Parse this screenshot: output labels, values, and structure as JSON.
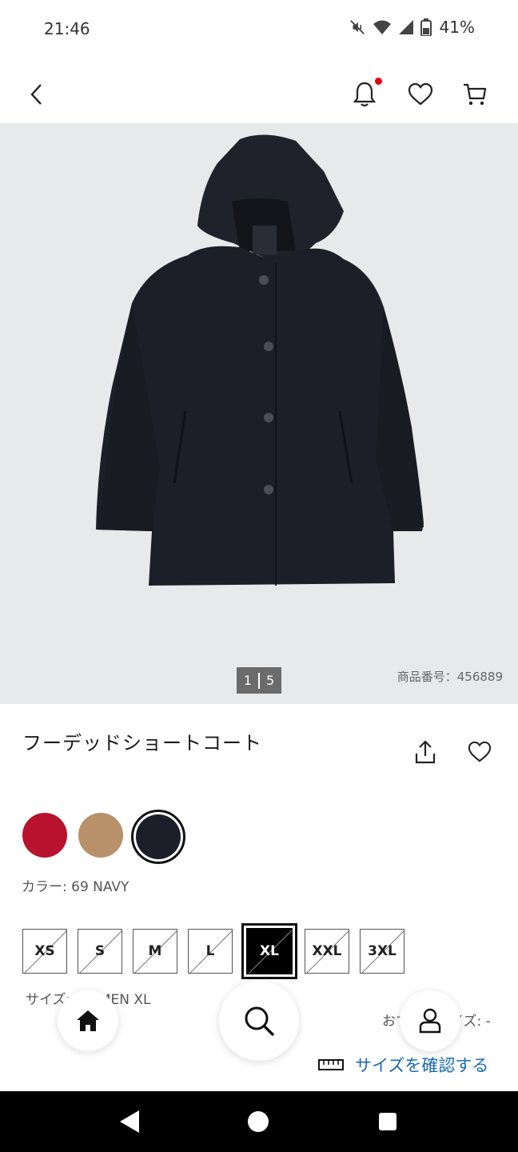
{
  "status_bar": {
    "time": "21:46",
    "battery_percent": "41%",
    "icons": [
      "mute-icon",
      "wifi-icon",
      "signal-icon",
      "battery-icon"
    ]
  },
  "header": {
    "icons": [
      "back-icon",
      "bell-icon",
      "heart-icon",
      "cart-icon"
    ],
    "notification_dot_color": "#e60012"
  },
  "gallery": {
    "current": "1",
    "total": "5",
    "product_code": "商品番号：456889"
  },
  "product": {
    "title": "フーデッドショートコート"
  },
  "colors": {
    "swatches": [
      {
        "name": "red",
        "hex": "#b8122e"
      },
      {
        "name": "beige",
        "hex": "#b8906a"
      },
      {
        "name": "navy",
        "hex": "#1c1f29"
      }
    ],
    "selected_index": 2,
    "label": "カラー: 69 NAVY"
  },
  "sizes": {
    "options": [
      "XS",
      "S",
      "M",
      "L",
      "XL",
      "XXL",
      "3XL"
    ],
    "selected": "XL",
    "label": "サイズ: WOMEN XL",
    "recommended_label": "おすすめサイズ: -"
  },
  "bottom_nav": {
    "icons": [
      "home-icon",
      "search-icon",
      "account-icon"
    ],
    "size_check": "サイズを確認する",
    "link_color": "#1b6bb0"
  }
}
